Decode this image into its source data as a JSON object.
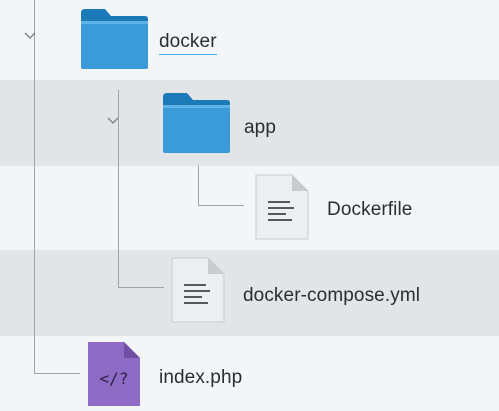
{
  "tree": {
    "items": [
      {
        "label": "docker",
        "icon": "folder-icon",
        "expanded": true,
        "selected": true
      },
      {
        "label": "app",
        "icon": "folder-icon",
        "expanded": true
      },
      {
        "label": "Dockerfile",
        "icon": "text-file-icon"
      },
      {
        "label": "docker-compose.yml",
        "icon": "text-file-icon"
      },
      {
        "label": "index.php",
        "icon": "php-file-icon",
        "icon_glyph": "</?"
      }
    ]
  },
  "colors": {
    "folder_blue": "#3a9bd8",
    "folder_tab": "#1d7ab8",
    "php_purple": "#8e6bc4",
    "selection_underline": "#3daee9",
    "row_alt": "#e2e5e7"
  }
}
